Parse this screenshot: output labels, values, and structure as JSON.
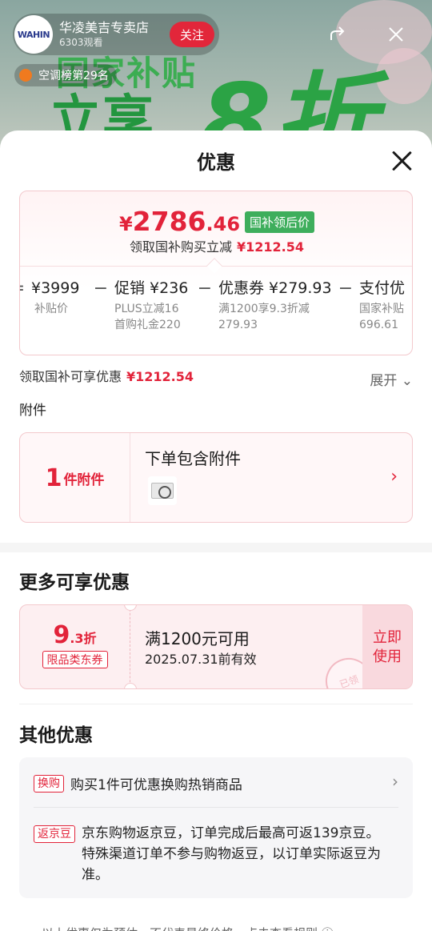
{
  "live": {
    "store_logo_text": "WAHIN",
    "store_name": "华凌美吉专卖店",
    "views": "6303观看",
    "follow_label": "关注",
    "rank_label": "空调榜第29名",
    "banner_line1": "国家补贴",
    "banner_line2": "立享",
    "banner_big": "8折",
    "share_icon": "share-icon",
    "close_icon": "close-icon"
  },
  "sheet": {
    "title": "优惠",
    "close_icon": "close-icon"
  },
  "price": {
    "symbol": "¥",
    "integer": "2786",
    "decimal": ".46",
    "tag": "国补领后价",
    "sub_label": "领取国补购买立减",
    "sub_amount": "¥1212.54"
  },
  "breakdown": [
    {
      "op": "=",
      "amount": "¥3999",
      "label1": "补贴价",
      "label2": ""
    },
    {
      "op": "−",
      "amount": "促销 ¥236",
      "label1": "PLUS立减16",
      "label2": "首购礼金220"
    },
    {
      "op": "−",
      "amount": "优惠券 ¥279.93",
      "label1": "满1200享9.3折减",
      "label2": "279.93"
    },
    {
      "op": "−",
      "amount": "支付优",
      "label1": "国家补贴",
      "label2": "696.61"
    }
  ],
  "saving": {
    "label": "领取国补可享优惠",
    "amount": "¥1212.54",
    "expand_label": "展开 ⌄"
  },
  "accessory": {
    "section_label": "附件",
    "count": "1",
    "count_unit": "件附件",
    "title": "下单包含附件",
    "arrow": "›"
  },
  "more": {
    "title": "更多可享优惠",
    "coupon": {
      "discount_big": "9",
      "discount_small": ".3折",
      "type": "限品类东券",
      "condition": "满1200元可用",
      "expiry": "2025.07.31前有效",
      "button_line1": "立即",
      "button_line2": "使用",
      "stamp": "已领"
    }
  },
  "other": {
    "title": "其他优惠",
    "items": [
      {
        "badge": "换购",
        "text": "购买1件可优惠换购热销商品",
        "arrow": "›"
      },
      {
        "badge": "返京豆",
        "text": "京东购物返京豆，订单完成后最高可返139京豆。特殊渠道订单不参与购物返豆，以订单实际返豆为准。"
      }
    ]
  },
  "footer": {
    "text": "以上优惠仅为预估，不代表最终价格，点击查看规则 ⓘ"
  }
}
